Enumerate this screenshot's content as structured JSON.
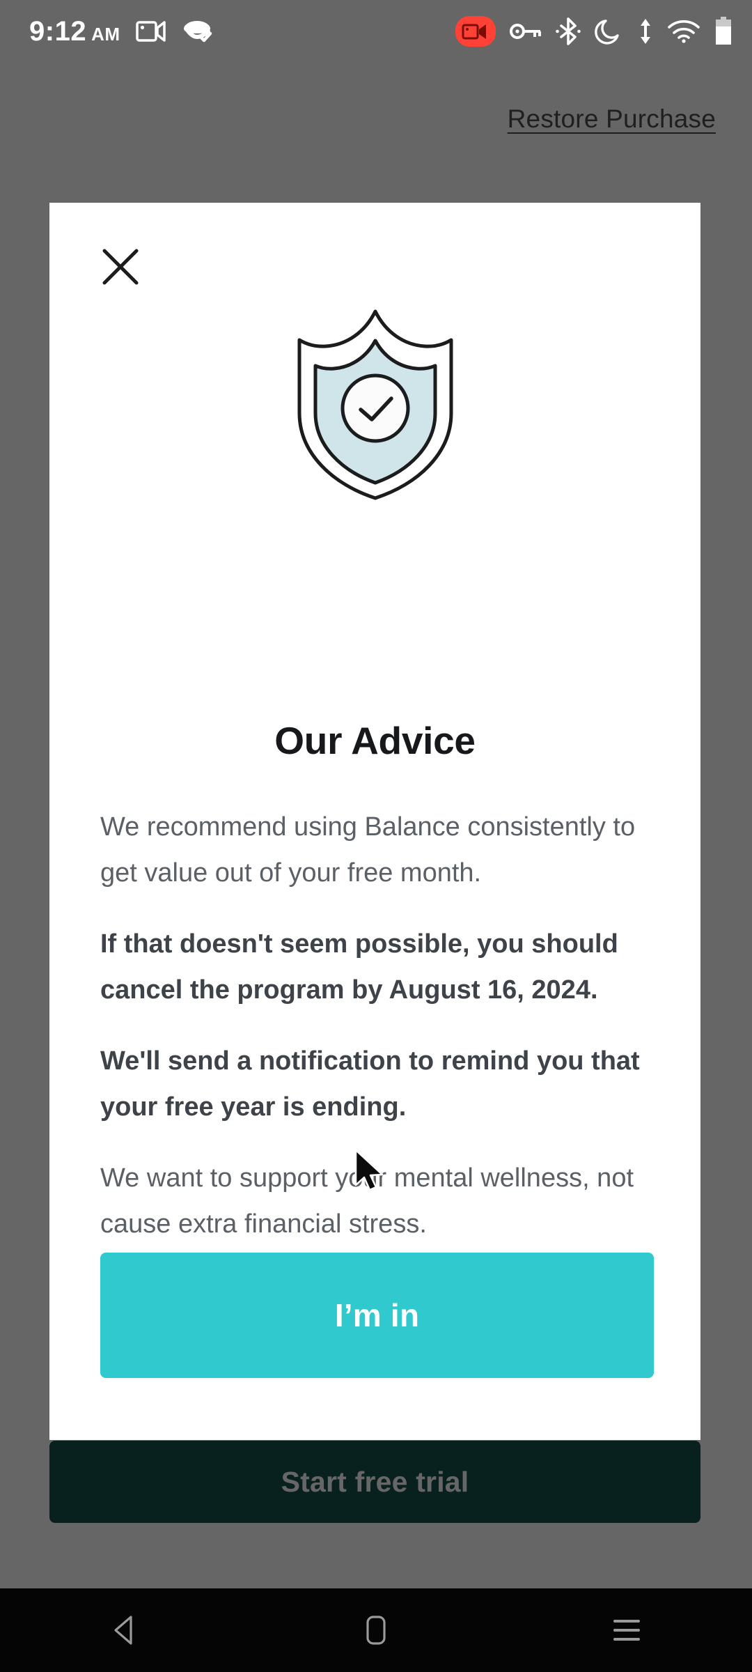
{
  "status_bar": {
    "time": "9:12",
    "meridiem": "AM",
    "icons": [
      "screen-record-camera-icon",
      "vpn-check-icon",
      "recording-active-icon",
      "vpn-key-icon",
      "bluetooth-icon",
      "do-not-disturb-moon-icon",
      "data-transfer-icon",
      "wifi-icon",
      "battery-icon"
    ]
  },
  "app": {
    "restore_purchase_label": "Restore Purchase",
    "start_trial_label": "Start free trial"
  },
  "modal": {
    "close_label": "Close",
    "illustration": "shield-check-icon",
    "title": "Our Advice",
    "paragraphs": [
      {
        "text": "We recommend using Balance consistently to get value out of your free month.",
        "bold": false
      },
      {
        "text": "If that doesn't seem possible, you should cancel the program by August 16, 2024.",
        "bold": true
      },
      {
        "text": "We'll send a notification to remind you that your free year is ending.",
        "bold": true
      },
      {
        "text": "We want to support your mental wellness, not cause extra financial stress.",
        "bold": false
      }
    ],
    "primary_button_label": "I’m in"
  },
  "nav_bar": {
    "back_label": "Back",
    "home_label": "Home",
    "recents_label": "Recent apps"
  },
  "colors": {
    "accent_teal": "#2fc9ce",
    "dark_teal": "#14534f",
    "shield_fill": "#cfe5ea",
    "scrim": "rgba(0,0,0,0.60)",
    "body_text": "#5b6066"
  }
}
